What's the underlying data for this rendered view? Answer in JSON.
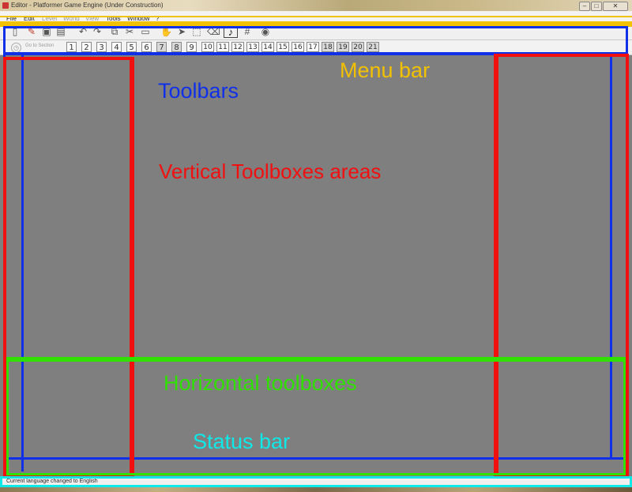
{
  "window": {
    "title": "Editor - Platformer Game Engine (Under Construction)",
    "minimize": "–",
    "maximize": "□",
    "close": "✕"
  },
  "menubar": {
    "items": [
      {
        "label": "File",
        "enabled": true
      },
      {
        "label": "Edit",
        "enabled": true
      },
      {
        "label": "Level",
        "enabled": false
      },
      {
        "label": "World",
        "enabled": false
      },
      {
        "label": "View",
        "enabled": false
      },
      {
        "label": "Tools",
        "enabled": true
      },
      {
        "label": "Window",
        "enabled": true
      },
      {
        "label": "?",
        "enabled": true
      }
    ]
  },
  "toolbar1": {
    "icons": [
      {
        "name": "new-icon",
        "glyph": "▯"
      },
      {
        "name": "open-icon",
        "glyph": "✎"
      },
      {
        "name": "save-icon",
        "glyph": "▣"
      },
      {
        "name": "save-all-icon",
        "glyph": "▤"
      },
      {
        "name": "undo-icon",
        "glyph": "↶"
      },
      {
        "name": "redo-icon",
        "glyph": "↷"
      },
      {
        "name": "copy-icon",
        "glyph": "⧉"
      },
      {
        "name": "cut-icon",
        "glyph": "✂"
      },
      {
        "name": "paste-icon",
        "glyph": "▭"
      },
      {
        "name": "hand-icon",
        "glyph": "✋"
      },
      {
        "name": "select-arrow-icon",
        "glyph": "➤"
      },
      {
        "name": "selection-rect-icon",
        "glyph": "⬚"
      },
      {
        "name": "eraser-icon",
        "glyph": "⌫"
      },
      {
        "name": "music-note-icon",
        "glyph": "♪"
      },
      {
        "name": "grid-icon",
        "glyph": "#"
      },
      {
        "name": "camera-icon",
        "glyph": "◉"
      }
    ]
  },
  "toolbar2": {
    "goto_label": "Go to Section",
    "sections": [
      "1",
      "2",
      "3",
      "4",
      "5",
      "6",
      "7",
      "8",
      "9",
      "10",
      "11",
      "12",
      "13",
      "14",
      "15",
      "16",
      "17",
      "18",
      "19",
      "20",
      "21"
    ],
    "highlighted": [
      "7",
      "8",
      "18",
      "19",
      "20",
      "21"
    ]
  },
  "statusbar": {
    "message": "Current language changed to English"
  },
  "annotations": {
    "menu_bar": {
      "label": "Menu bar",
      "color": "#f2c100"
    },
    "toolbars": {
      "label": "Toolbars",
      "color": "#1030e8"
    },
    "vertical_toolboxes": {
      "label": "Vertical Toolboxes areas",
      "color": "#f01010"
    },
    "horizontal_toolboxes": {
      "label": "Horizontal toolboxes",
      "color": "#30e000"
    },
    "status_bar": {
      "label": "Status bar",
      "color": "#10e8e8"
    }
  }
}
